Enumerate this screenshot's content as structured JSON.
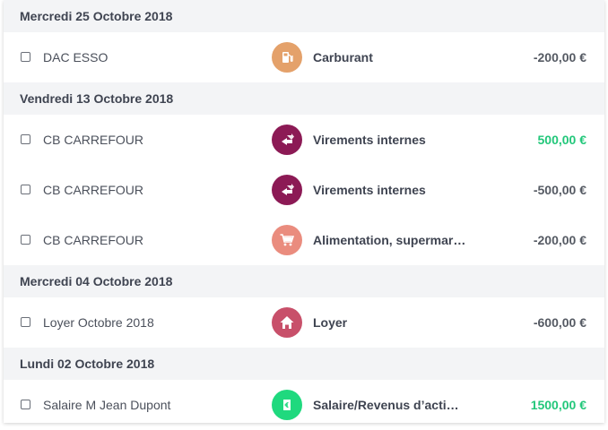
{
  "groups": [
    {
      "date": "Mercredi 25 Octobre 2018",
      "transactions": [
        {
          "label": "DAC ESSO",
          "category": "Carburant",
          "icon": "fuel-pump-icon",
          "color": "#e4a16a",
          "amount": "-200,00 €",
          "positive": false
        }
      ]
    },
    {
      "date": "Vendredi 13 Octobre 2018",
      "transactions": [
        {
          "label": "CB CARREFOUR",
          "category": "Virements internes",
          "icon": "transfer-icon",
          "color": "#8c1a55",
          "amount": "500,00 €",
          "positive": true
        },
        {
          "label": "CB CARREFOUR",
          "category": "Virements internes",
          "icon": "transfer-icon",
          "color": "#8c1a55",
          "amount": "-500,00 €",
          "positive": false
        },
        {
          "label": "CB CARREFOUR",
          "category": "Alimentation, supermar…",
          "icon": "shopping-cart-icon",
          "color": "#ea8c7e",
          "amount": "-200,00 €",
          "positive": false
        }
      ]
    },
    {
      "date": "Mercredi 04 Octobre 2018",
      "transactions": [
        {
          "label": "Loyer Octobre 2018",
          "category": "Loyer",
          "icon": "house-icon",
          "color": "#c8506a",
          "amount": "-600,00 €",
          "positive": false
        }
      ]
    },
    {
      "date": "Lundi 02 Octobre 2018",
      "transactions": [
        {
          "label": "Salaire M Jean Dupont",
          "category": "Salaire/Revenus d’acti…",
          "icon": "money-icon",
          "color": "#1fd97e",
          "amount": "1500,00 €",
          "positive": true
        }
      ]
    }
  ],
  "colors": {
    "positive_amount": "#22c77a",
    "negative_amount": "#555a63",
    "header_bg": "#f3f4f6"
  }
}
